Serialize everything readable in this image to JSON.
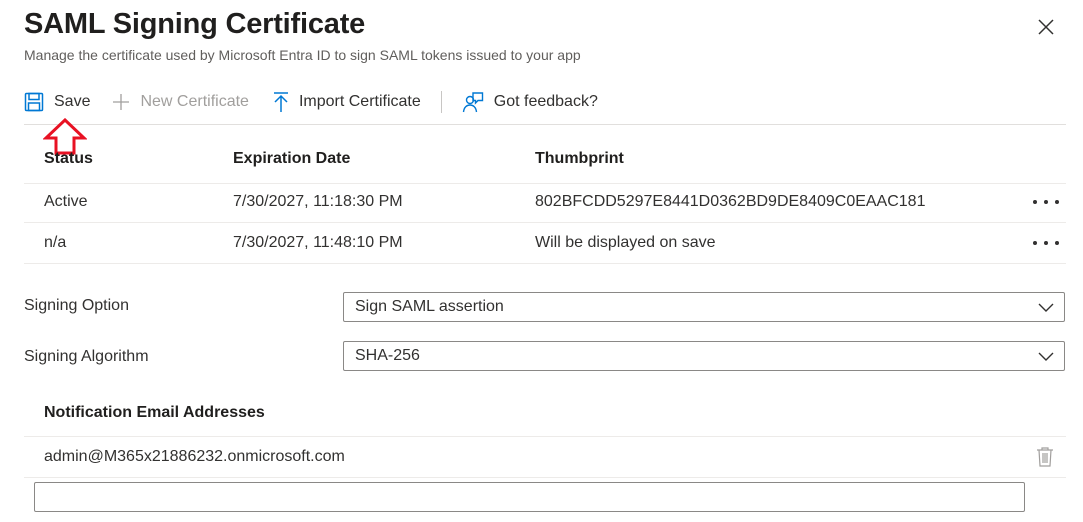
{
  "panel": {
    "title": "SAML Signing Certificate",
    "subtitle": "Manage the certificate used by Microsoft Entra ID to sign SAML tokens issued to your app"
  },
  "toolbar": {
    "save_label": "Save",
    "new_cert_label": "New Certificate",
    "import_label": "Import Certificate",
    "feedback_label": "Got feedback?"
  },
  "certificates": {
    "headers": [
      "Status",
      "Expiration Date",
      "Thumbprint"
    ],
    "rows": [
      {
        "status": "Active",
        "expiration": "7/30/2027, 11:18:30 PM",
        "thumbprint": "802BFCDD5297E8441D0362BD9DE8409C0EAAC181"
      },
      {
        "status": "n/a",
        "expiration": "7/30/2027, 11:48:10 PM",
        "thumbprint": "Will be displayed on save"
      }
    ]
  },
  "signing": {
    "option_label": "Signing Option",
    "option_value": "Sign SAML assertion",
    "algorithm_label": "Signing Algorithm",
    "algorithm_value": "SHA-256"
  },
  "notifications": {
    "header": "Notification Email Addresses",
    "emails": [
      "admin@M365x21886232.onmicrosoft.com"
    ],
    "new_email_value": ""
  },
  "colors": {
    "accent": "#0078d4",
    "annotation_arrow": "#e81123",
    "disabled_text": "#a19f9d"
  }
}
